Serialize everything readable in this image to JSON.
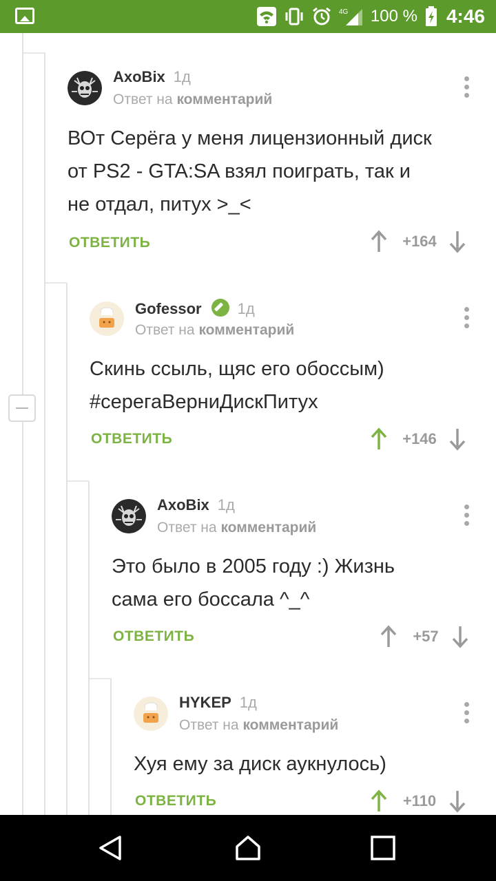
{
  "status_bar": {
    "battery": "100 %",
    "time": "4:46",
    "network": "4G",
    "icons": [
      "image-icon",
      "wifi-icon",
      "vibrate-icon",
      "alarm-icon",
      "signal-icon",
      "battery-charging-icon"
    ]
  },
  "labels": {
    "reply_to_prefix": "Ответ на",
    "reply_to_target": "комментарий",
    "answer_button": "ОТВЕТИТЬ"
  },
  "comments": [
    {
      "author": "AxoBix",
      "age": "1д",
      "text_lines": [
        "ВОт Серёга у меня лицензионный диск",
        "от  PS2 - GTA:SA взял поиграть, так и",
        "не отдал, питух >_<"
      ],
      "score": "+164",
      "upvoted": false
    },
    {
      "author": "Gofessor",
      "age": "1д",
      "verified": true,
      "text_lines": [
        "Скинь ссыль, щяс его обоссым)",
        "#серегаВерниДискПитух"
      ],
      "score": "+146",
      "upvoted": true
    },
    {
      "author": "AxoBix",
      "age": "1д",
      "text_lines": [
        "Это было в 2005 году :) Жизнь",
        "сама его боссала ^_^"
      ],
      "score": "+57",
      "upvoted": false
    },
    {
      "author": "HYKEP",
      "age": "1д",
      "text_lines": [
        "Хуя ему за диск аукнулось)"
      ],
      "score": "+110",
      "upvoted": true
    }
  ],
  "colors": {
    "status_bar": "#5c9a2c",
    "accent": "#7cb342",
    "muted": "#9a9a9a"
  }
}
